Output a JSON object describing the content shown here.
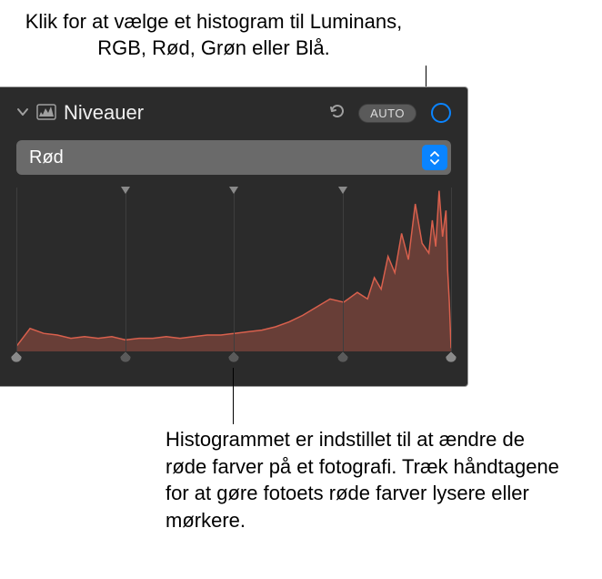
{
  "callouts": {
    "top": "Klik for at vælge et histogram til Luminans, RGB, Rød, Grøn eller Blå.",
    "bottom": "Histogrammet er indstillet til at ændre de røde farver på et fotografi. Træk håndtagene for at gøre fotoets røde farver lysere eller mørkere."
  },
  "panel": {
    "title": "Niveauer",
    "auto_label": "AUTO",
    "dropdown_value": "Rød",
    "histogram_color": "#d9604d"
  },
  "chart_data": {
    "type": "area",
    "title": "",
    "xlabel": "",
    "ylabel": "",
    "xlim": [
      0,
      255
    ],
    "ylim": [
      0,
      100
    ],
    "series": [
      {
        "name": "Rød",
        "x": [
          0,
          8,
          16,
          24,
          32,
          40,
          48,
          56,
          64,
          72,
          80,
          88,
          96,
          104,
          112,
          120,
          128,
          136,
          144,
          152,
          160,
          168,
          176,
          184,
          192,
          200,
          206,
          210,
          214,
          218,
          222,
          226,
          230,
          234,
          238,
          242,
          244,
          246,
          248,
          250,
          252,
          253,
          254,
          255
        ],
        "values": [
          3,
          14,
          11,
          10,
          8,
          9,
          8,
          9,
          7,
          8,
          8,
          9,
          8,
          9,
          10,
          10,
          11,
          12,
          13,
          15,
          18,
          22,
          27,
          32,
          30,
          36,
          32,
          45,
          38,
          58,
          48,
          72,
          56,
          90,
          66,
          60,
          80,
          64,
          98,
          70,
          86,
          50,
          30,
          2
        ]
      }
    ],
    "handles_bottom": [
      0,
      25,
      50,
      75,
      100
    ],
    "handles_top": [
      25,
      50,
      75
    ]
  }
}
